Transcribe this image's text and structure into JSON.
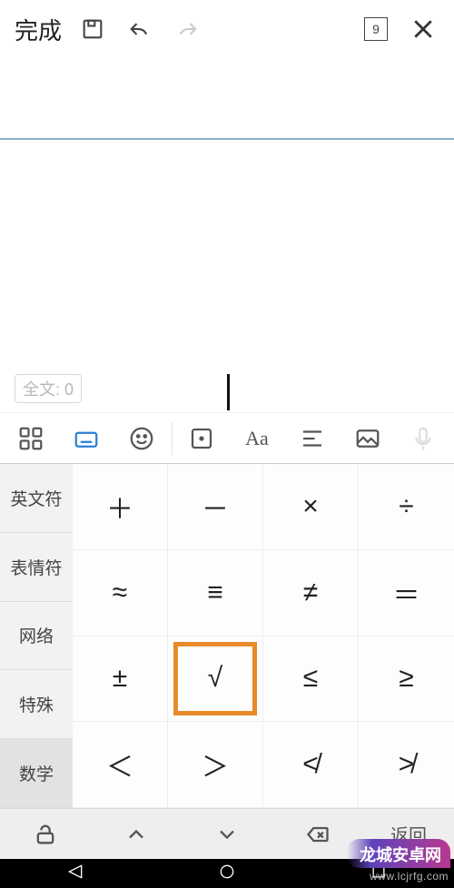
{
  "topbar": {
    "done": "完成",
    "page_number": "9"
  },
  "editor": {
    "word_count_label": "全文: 0"
  },
  "categories": [
    "英文符",
    "表情符",
    "网络",
    "特殊",
    "数学"
  ],
  "selected_category_index": 4,
  "symbols": [
    "＋",
    "－",
    "×",
    "÷",
    "≈",
    "≡",
    "≠",
    "＝",
    "±",
    "√",
    "≤",
    "≥",
    "＜",
    "＞",
    "≮",
    "≯"
  ],
  "highlight_index": 9,
  "bottom": {
    "return_label": "返回"
  },
  "toolbar2": {
    "text_tool": "Aa"
  },
  "watermark": {
    "brand": "龙城安卓网",
    "url": "www.lcjrfg.com"
  }
}
